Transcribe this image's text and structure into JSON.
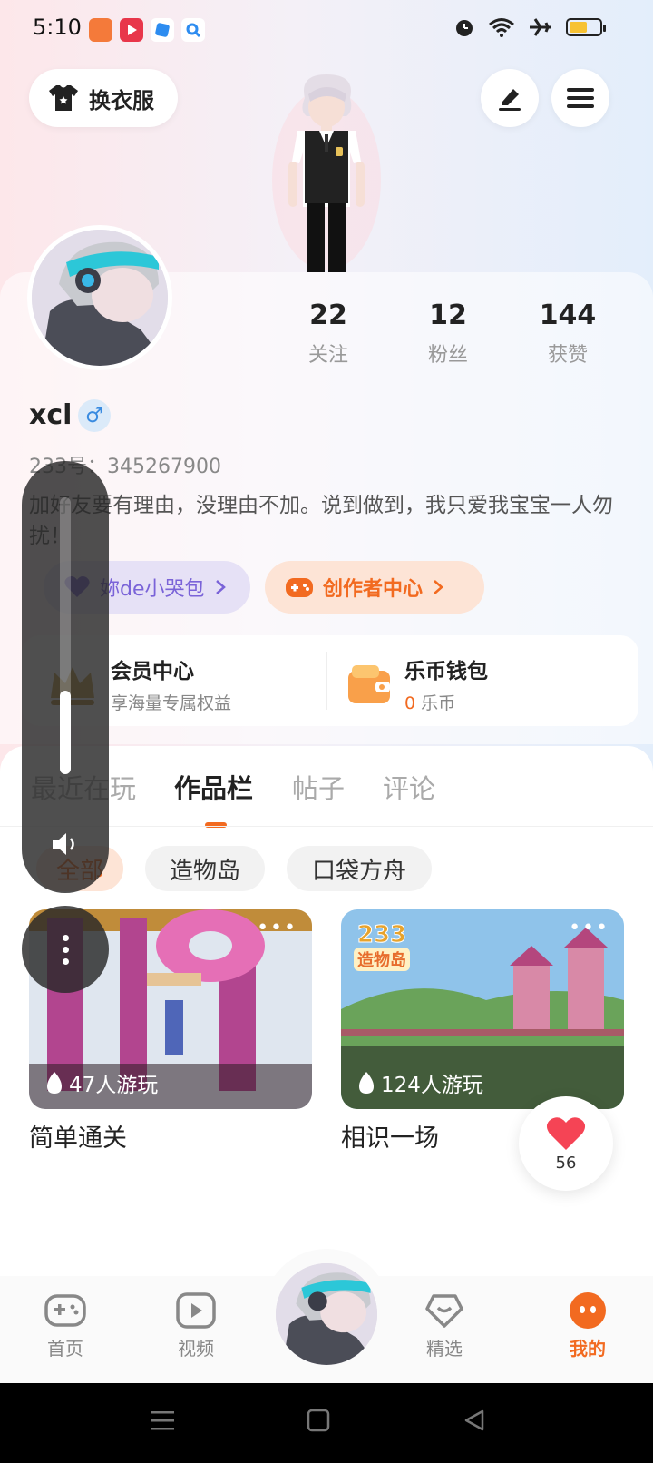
{
  "status_bar": {
    "time": "5:10"
  },
  "header": {
    "outfit_label": "换衣服"
  },
  "profile": {
    "stats": [
      {
        "value": "22",
        "label": "关注"
      },
      {
        "value": "12",
        "label": "粉丝"
      },
      {
        "value": "144",
        "label": "获赞"
      }
    ],
    "username": "xcl",
    "gender_symbol": "♂",
    "uid": "233号：345267900",
    "bio": "加好友要有理由，没理由不加。说到做到，我只爱我宝宝一人勿扰！"
  },
  "pills": {
    "badge_label": "妳de小哭包",
    "creator_label": "创作者中心"
  },
  "member": {
    "vip_title": "会员中心",
    "vip_sub": "享海量专属权益",
    "wallet_title": "乐币钱包",
    "wallet_amount": "0",
    "wallet_unit": "乐币"
  },
  "tabs": [
    {
      "label": "最近在玩"
    },
    {
      "label": "作品栏"
    },
    {
      "label": "帖子"
    },
    {
      "label": "评论"
    }
  ],
  "filters": [
    {
      "label": "全部"
    },
    {
      "label": "造物岛"
    },
    {
      "label": "口袋方舟"
    }
  ],
  "works": [
    {
      "title": "简单通关",
      "plays": "47人游玩"
    },
    {
      "title": "相识一场",
      "plays": "124人游玩",
      "logo": "233",
      "logo_sub": "造物岛"
    }
  ],
  "like": {
    "count": "56"
  },
  "volume": {
    "level": 0.3
  },
  "bottom_nav": [
    {
      "label": "首页"
    },
    {
      "label": "视频"
    },
    {
      "label": "精选"
    },
    {
      "label": "我的"
    }
  ],
  "colors": {
    "accent": "#f26a20",
    "purple": "#7a63d8",
    "gender_blue": "#3a8be0"
  }
}
